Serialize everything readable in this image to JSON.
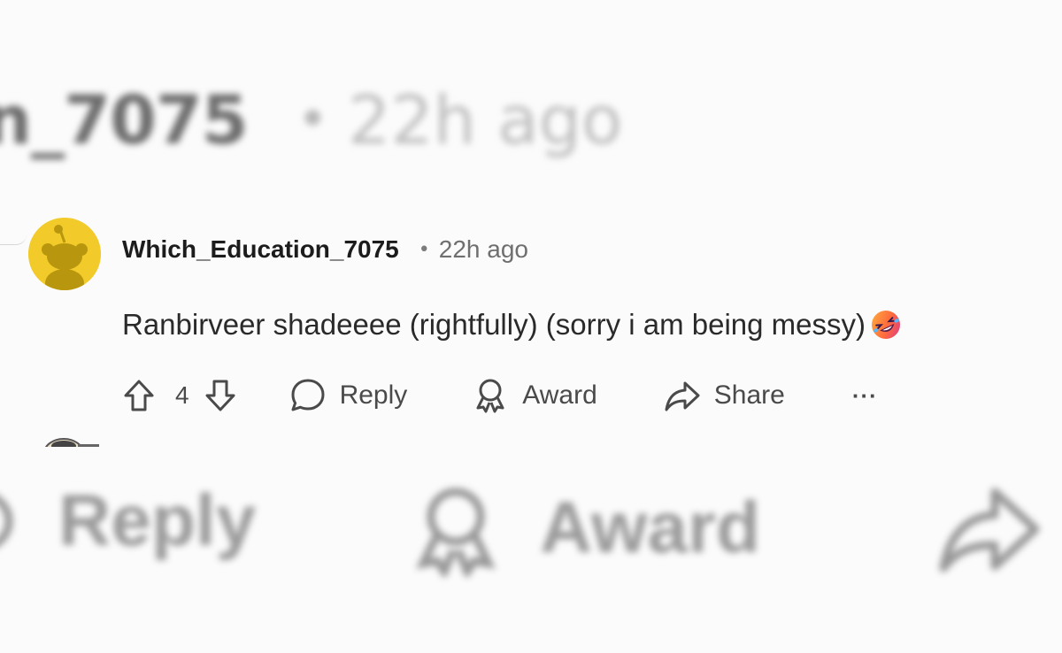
{
  "blurred_header": {
    "username": "n_7075",
    "separator": "•",
    "time": "22h ago"
  },
  "comment": {
    "username": "Which_Education_7075",
    "separator": "•",
    "time": "22h ago",
    "body": "Ranbirveer shadeeee (rightfully) (sorry i am being messy)",
    "emoji": "rolling-on-floor-laughing"
  },
  "actions": {
    "vote_count": "4",
    "reply_label": "Reply",
    "award_label": "Award",
    "share_label": "Share",
    "more_label": "···"
  },
  "blurred_actions": {
    "reply_label": "Reply",
    "award_label": "Award"
  },
  "colors": {
    "avatar_bg": "#f2cb2b",
    "avatar_fg": "#b8970e",
    "text_muted": "#6f6f6f",
    "background": "#fbfbfb"
  }
}
